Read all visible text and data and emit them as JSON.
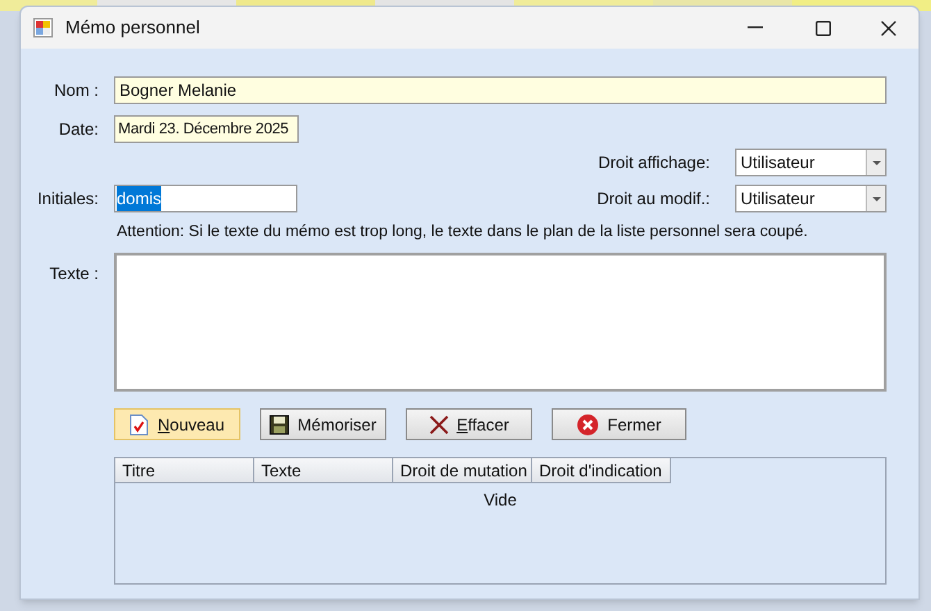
{
  "window": {
    "title": "Mémo personnel"
  },
  "form": {
    "nom": {
      "label": "Nom :",
      "value": "Bogner Melanie"
    },
    "date": {
      "label": "Date:",
      "value": "Mardi 23. Décembre 2025"
    },
    "droit_affichage": {
      "label": "Droit affichage:",
      "value": "Utilisateur"
    },
    "initiales": {
      "label": "Initiales:",
      "value": "domis",
      "value_selected": true
    },
    "droit_modif": {
      "label": "Droit au modif.:",
      "value": "Utilisateur"
    },
    "attention": "Attention: Si le texte du mémo est trop long, le texte dans le plan de la liste personnel sera coupé.",
    "texte": {
      "label": "Texte :"
    }
  },
  "buttons": [
    {
      "kind": "new",
      "label": "Nouveau",
      "first_letter_underlined": true,
      "highlighted": true
    },
    {
      "kind": "save",
      "label": "Mémoriser",
      "highlighted": false
    },
    {
      "kind": "delete",
      "label": "Effacer",
      "first_letter_underlined": true,
      "highlighted": false
    },
    {
      "kind": "close",
      "label": "Fermer",
      "highlighted": false
    }
  ],
  "table": {
    "columns": [
      "Titre",
      "Texte",
      "Droit de mutation",
      "Droit d'indication"
    ],
    "empty_text": "Vide"
  }
}
